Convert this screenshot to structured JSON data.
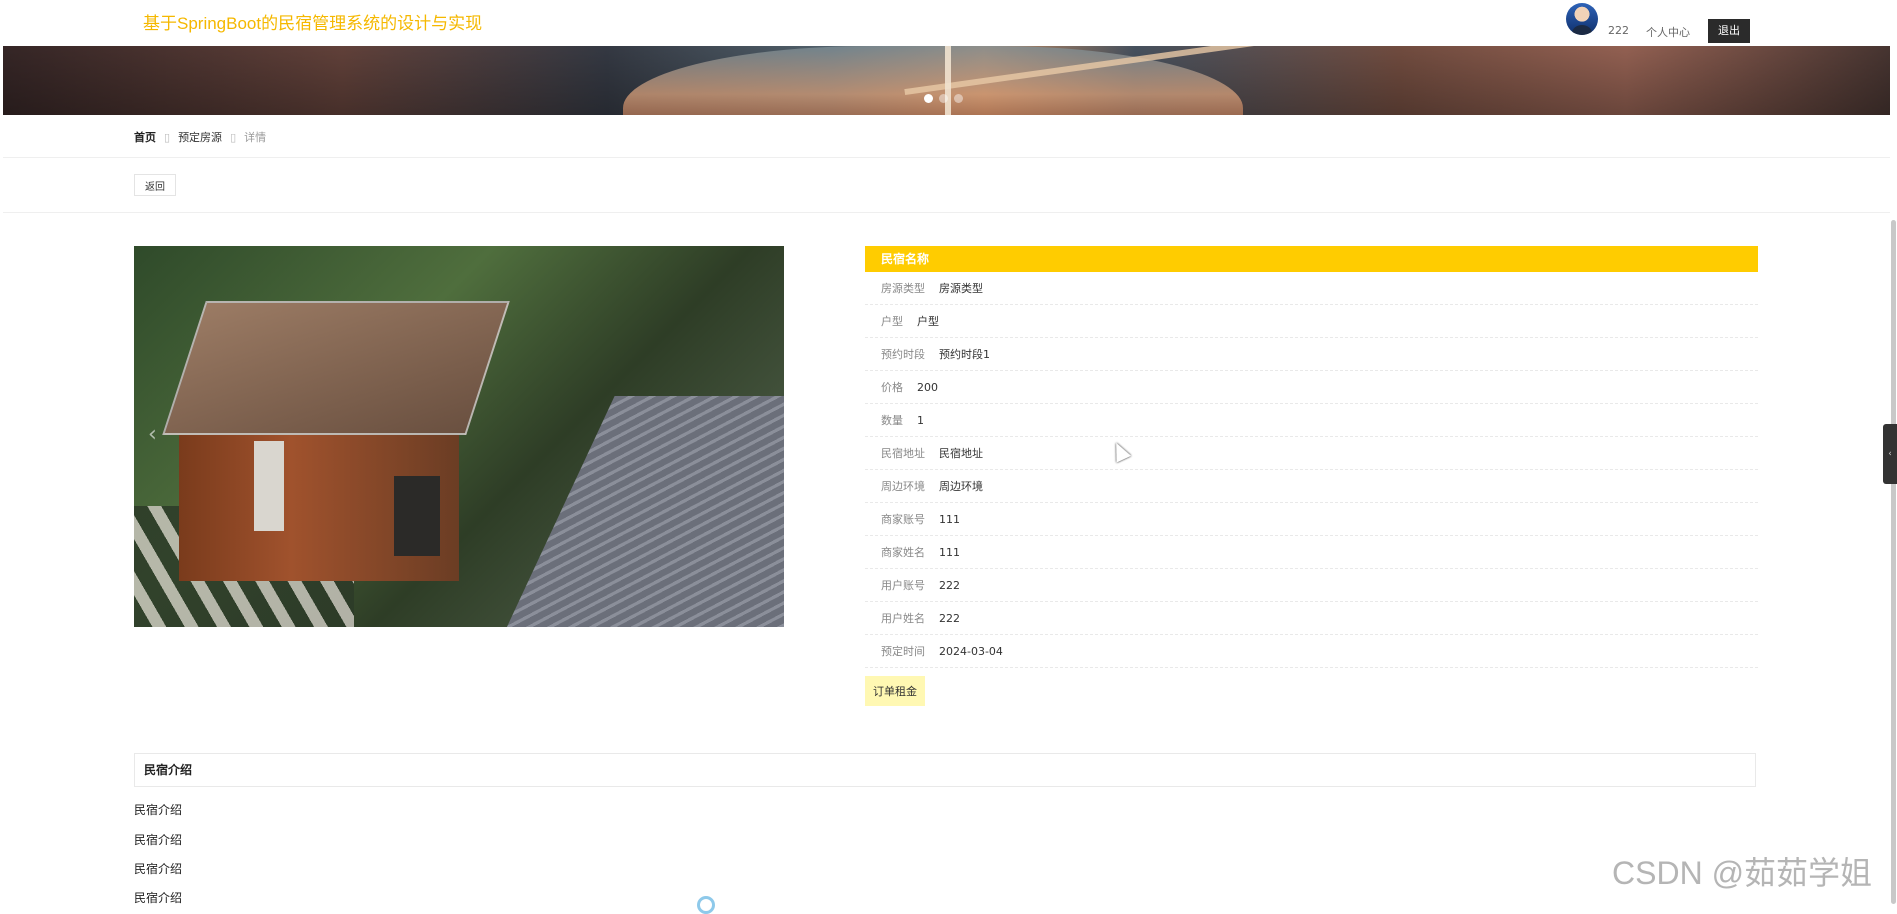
{
  "header": {
    "site_title": "基于SpringBoot的民宿管理系统的设计与实现",
    "user_name": "222",
    "user_center": "个人中心",
    "logout": "退出"
  },
  "breadcrumb": {
    "home": "首页",
    "section": "预定房源",
    "current": "详情"
  },
  "back_button": "返回",
  "detail": {
    "title": "民宿名称",
    "fields": [
      {
        "label": "房源类型",
        "value": "房源类型"
      },
      {
        "label": "户型",
        "value": "户型"
      },
      {
        "label": "预约时段",
        "value": "预约时段1"
      },
      {
        "label": "价格",
        "value": "200"
      },
      {
        "label": "数量",
        "value": "1"
      },
      {
        "label": "民宿地址",
        "value": "民宿地址"
      },
      {
        "label": "周边环境",
        "value": "周边环境"
      },
      {
        "label": "商家账号",
        "value": "111"
      },
      {
        "label": "商家姓名",
        "value": "111"
      },
      {
        "label": "用户账号",
        "value": "222"
      },
      {
        "label": "用户姓名",
        "value": "222"
      },
      {
        "label": "预定时间",
        "value": "2024-03-04"
      }
    ],
    "order_button": "订单租金"
  },
  "intro": {
    "title": "民宿介绍",
    "lines": [
      "民宿介绍",
      "民宿介绍",
      "民宿介绍",
      "民宿介绍"
    ]
  },
  "carousel": {
    "dot_count": 3,
    "active_index": 0
  },
  "icons": {
    "photo_prev": "chevron-left-icon",
    "side_tab": "chevron-left-icon",
    "scroll_up": "caret-up-icon"
  },
  "colors": {
    "accent": "#ffcc00",
    "title": "#f5b800",
    "order_button_bg": "#fff8b3",
    "logout_bg": "#2b2b2b"
  },
  "watermark": "CSDN @茹茹学姐"
}
